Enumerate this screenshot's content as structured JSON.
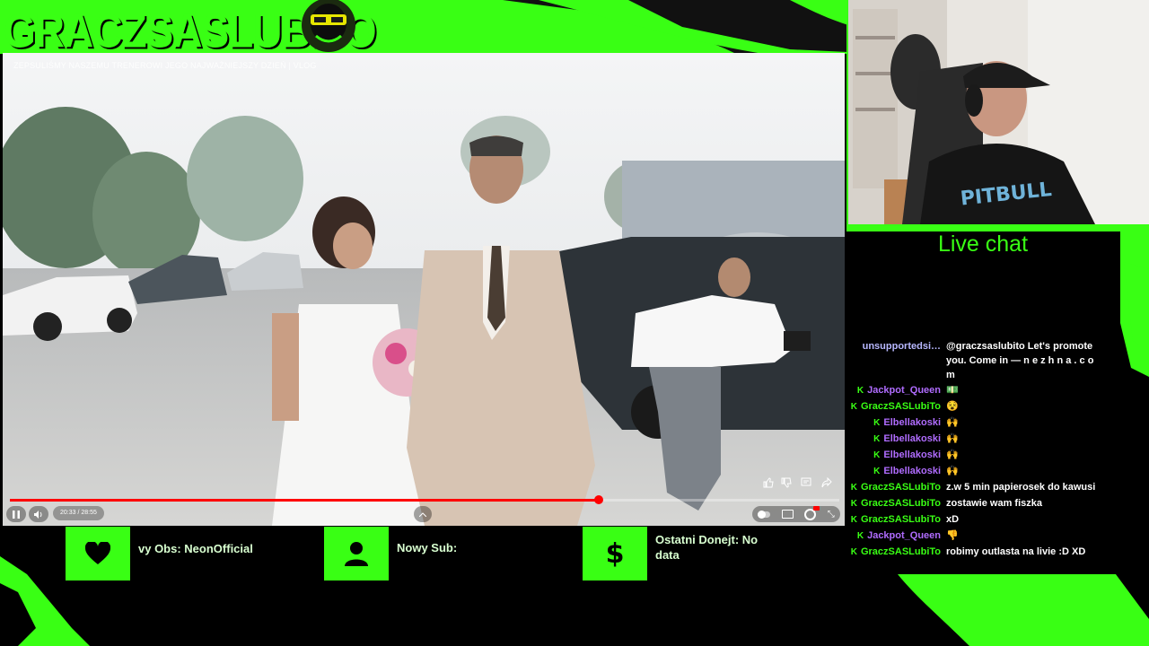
{
  "brand": {
    "title": "GRACZSASLUBITO"
  },
  "video": {
    "title": "ZEPSULIŚMY NASZEMU TRENEROWI JEGO NAJWAŻNIEJSZY DZIEŃ | VLOG",
    "time": "20:33 / 28:55",
    "progress": 0.7096
  },
  "chat": {
    "title": "Live chat",
    "messages": [
      {
        "user": "unsupportedsi…",
        "badge": "",
        "color": "#b8b8ff",
        "text": "@graczsaslubito Let's promote you. Come in — n e z h n a . c o m"
      },
      {
        "user": "Jackpot_Queen",
        "badge": "K",
        "color": "#b06cff",
        "text": "💵"
      },
      {
        "user": "GraczSASLubiTo",
        "badge": "K",
        "color": "#39ff14",
        "text": "😵"
      },
      {
        "user": "Elbellakoski",
        "badge": "K",
        "color": "#b06cff",
        "text": "🙌"
      },
      {
        "user": "Elbellakoski",
        "badge": "K",
        "color": "#b06cff",
        "text": "🙌"
      },
      {
        "user": "Elbellakoski",
        "badge": "K",
        "color": "#b06cff",
        "text": "🙌"
      },
      {
        "user": "Elbellakoski",
        "badge": "K",
        "color": "#b06cff",
        "text": "🙌"
      },
      {
        "user": "GraczSASLubiTo",
        "badge": "K",
        "color": "#39ff14",
        "text": "z.w 5 min papierosek do kawusi"
      },
      {
        "user": "GraczSASLubiTo",
        "badge": "K",
        "color": "#39ff14",
        "text": "zostawie wam fiszka"
      },
      {
        "user": "GraczSASLubiTo",
        "badge": "K",
        "color": "#39ff14",
        "text": "xD"
      },
      {
        "user": "Jackpot_Queen",
        "badge": "K",
        "color": "#b06cff",
        "text": "👎"
      },
      {
        "user": "GraczSASLubiTo",
        "badge": "K",
        "color": "#39ff14",
        "text": "robimy outlasta na livie :D XD"
      }
    ]
  },
  "stats": {
    "follower": "vy Obs: NeonOfficial",
    "sub": "Nowy Sub:",
    "donation": "Ostatni Donejt: No data"
  },
  "icons": [
    "heart-icon",
    "person-icon",
    "dollar-icon",
    "pause-icon",
    "volume-icon",
    "like-icon",
    "dislike-icon",
    "comment-icon",
    "share-icon",
    "autoplay-toggle",
    "subtitles-icon",
    "settings-icon",
    "fullscreen-exit-icon"
  ],
  "colors": {
    "accent": "#39ff14",
    "background": "#000000",
    "progress": "#ff0000"
  }
}
